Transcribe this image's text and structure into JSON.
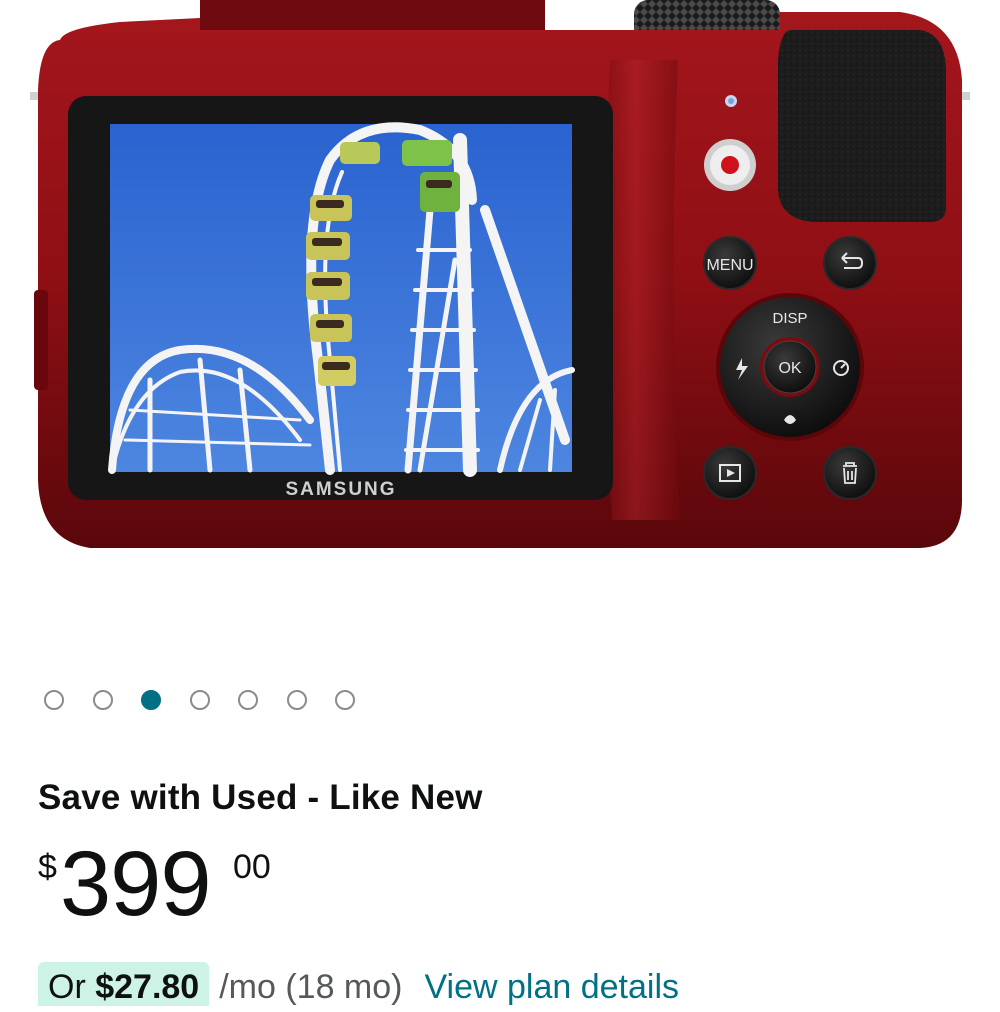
{
  "product_image": {
    "screen_brand": "SAMSUNG",
    "buttons": {
      "menu": "MENU",
      "disp": "DISP",
      "ok": "OK"
    },
    "colors": {
      "body": "#8e0f14",
      "body_dark": "#5a070b",
      "sky": "#2f6fd6"
    }
  },
  "carousel": {
    "count": 7,
    "active_index": 2
  },
  "offer": {
    "heading": "Save with Used - Like New"
  },
  "price": {
    "symbol": "$",
    "whole": "399",
    "fraction": "00"
  },
  "monthly": {
    "prefix": "Or ",
    "amount": "$27.80",
    "term": "/mo (18 mo)",
    "link": "View plan details"
  },
  "colors": {
    "accent_link": "#007185",
    "badge_bg": "#cdf3e6"
  }
}
